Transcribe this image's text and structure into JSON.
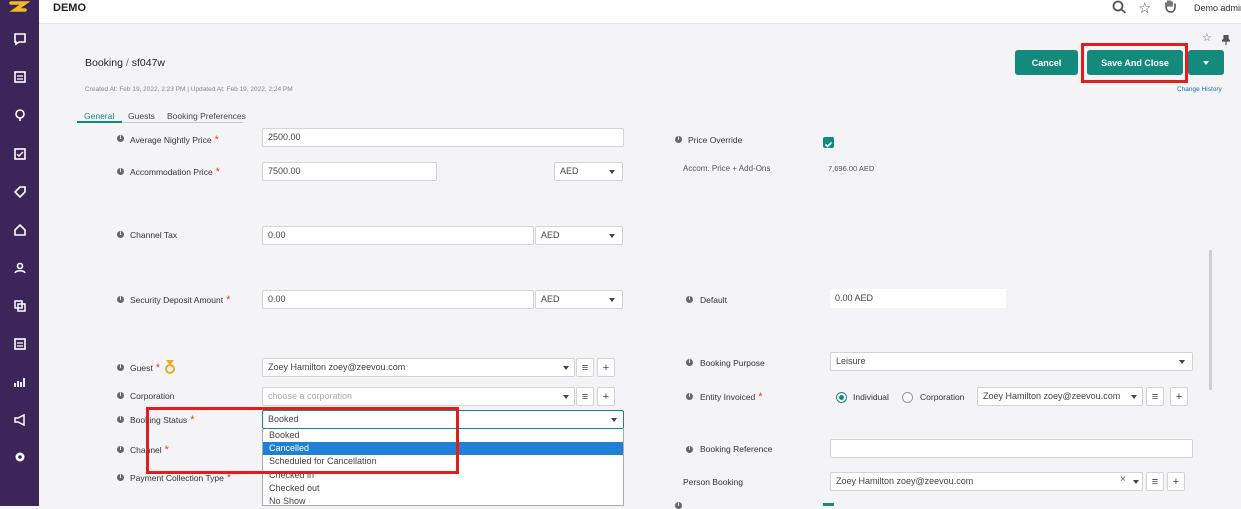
{
  "app": {
    "brand": "DEMO",
    "user": "Demo admin"
  },
  "sidebar": {
    "icons": [
      "chat-icon",
      "inbox-icon",
      "map-pin-icon",
      "checklist-icon",
      "tag-icon",
      "home-icon",
      "user-icon",
      "copy-icon",
      "calendar-icon",
      "chart-icon",
      "megaphone-icon",
      "gear-icon"
    ]
  },
  "header": {
    "breadcrumb_parent": "Booking",
    "breadcrumb_sep": "/",
    "breadcrumb_current": "sf047w",
    "meta": "Created At: Feb 19, 2022, 2:23 PM  |  Updated At: Feb 19, 2022, 2:24 PM",
    "cancel_label": "Cancel",
    "save_label": "Save And Close",
    "change_history": "Change History"
  },
  "tabs": [
    "General",
    "Guests",
    "Booking Preferences"
  ],
  "form": {
    "avg_nightly_label": "Average Nightly Price",
    "avg_nightly_value": "2500.00",
    "accom_label": "Accommodation Price",
    "accom_value": "7500.00",
    "accom_currency": "AED",
    "price_override_label": "Price Override",
    "accom_addons_label": "Accom. Price + Add-Ons",
    "accom_addons_value": "7,696.00 AED",
    "channel_tax_label": "Channel Tax",
    "channel_tax_value": "0.00",
    "channel_tax_currency": "AED",
    "security_label": "Security Deposit Amount",
    "security_value": "0.00",
    "security_currency": "AED",
    "default_label": "Default",
    "default_value": "0.00 AED",
    "guest_label": "Guest",
    "guest_value": "Zoey Hamilton zoey@zeevou.com",
    "booking_purpose_label": "Booking Purpose",
    "booking_purpose_value": "Leisure",
    "corporation_label": "Corporation",
    "corporation_placeholder": "choose a corporation",
    "entity_label": "Entity Invoiced",
    "entity_individual": "Individual",
    "entity_corporation": "Corporation",
    "entity_value": "Zoey Hamilton zoey@zeevou.com",
    "booking_status_label": "Booking Status",
    "booking_status_value": "Booked",
    "channel_label": "Channel",
    "booking_reference_label": "Booking Reference",
    "payment_label": "Payment Collection Type",
    "person_booking_label": "Person Booking",
    "person_booking_value": "Zoey Hamilton zoey@zeevou.com"
  },
  "status_options": [
    "Booked",
    "Cancelled",
    "Scheduled for Cancellation",
    "Checked in",
    "Checked out",
    "No Show"
  ],
  "colors": {
    "accent": "#148a7c",
    "sidebar": "#3c2559",
    "highlight": "#e01e1e",
    "selected": "#1f80d6"
  }
}
